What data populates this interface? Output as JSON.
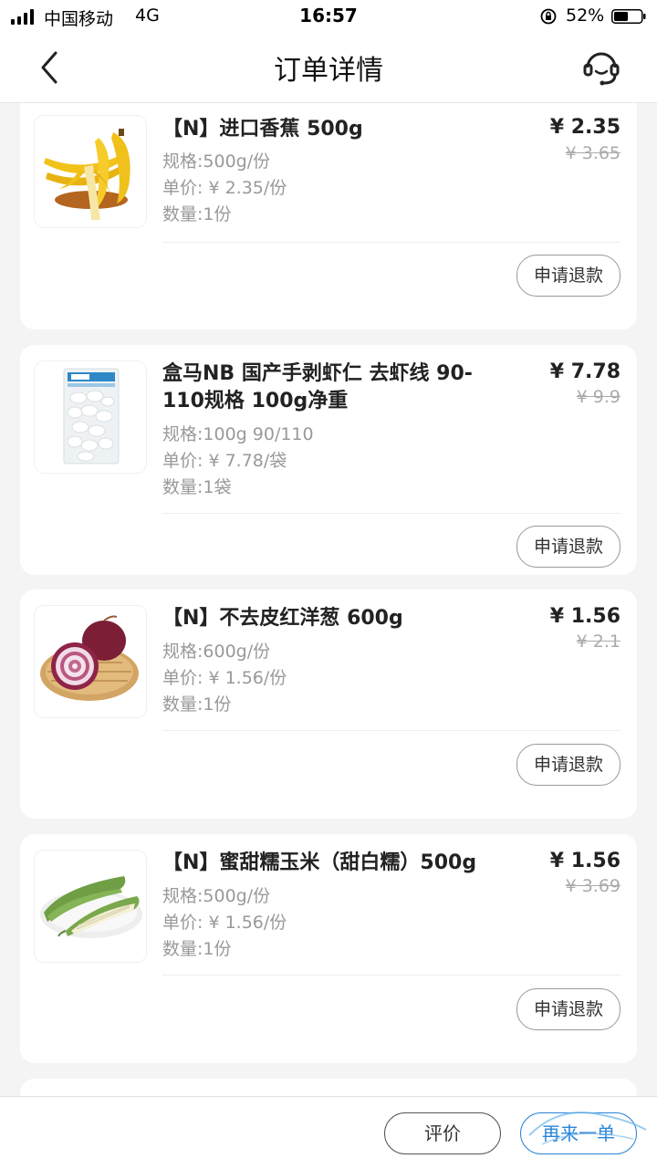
{
  "status_bar": {
    "carrier": "中国移动",
    "network": "4G",
    "time": "16:57",
    "battery": "52%"
  },
  "header": {
    "title": "订单详情",
    "back_icon": "chevron-left-icon",
    "service_icon": "customer-service-headset-icon"
  },
  "items": [
    {
      "name": "【N】进口香蕉 500g",
      "spec": "规格:500g/份",
      "unit_price": "单价: ¥ 2.35/份",
      "quantity": "数量:1份",
      "price": "¥ 2.35",
      "original_price": "¥ 3.65",
      "refund_label": "申请退款"
    },
    {
      "name": "盒马NB 国产手剥虾仁 去虾线 90-110规格 100g净重",
      "spec": "规格:100g 90/110",
      "unit_price": "单价: ¥ 7.78/袋",
      "quantity": "数量:1袋",
      "price": "¥ 7.78",
      "original_price": "¥ 9.9",
      "refund_label": "申请退款"
    },
    {
      "name": "【N】不去皮红洋葱 600g",
      "spec": "规格:600g/份",
      "unit_price": "单价: ¥ 1.56/份",
      "quantity": "数量:1份",
      "price": "¥ 1.56",
      "original_price": "¥ 2.1",
      "refund_label": "申请退款"
    },
    {
      "name": "【N】蜜甜糯玉米（甜白糯）500g",
      "spec": "规格:500g/份",
      "unit_price": "单价: ¥ 1.56/份",
      "quantity": "数量:1份",
      "price": "¥ 1.56",
      "original_price": "¥ 3.69",
      "refund_label": "申请退款"
    }
  ],
  "bottom_bar": {
    "review_label": "评价",
    "rebuy_label": "再来一单"
  },
  "colors": {
    "accent": "#2a84d8",
    "background": "#f4f4f4",
    "muted_text": "#999999"
  }
}
